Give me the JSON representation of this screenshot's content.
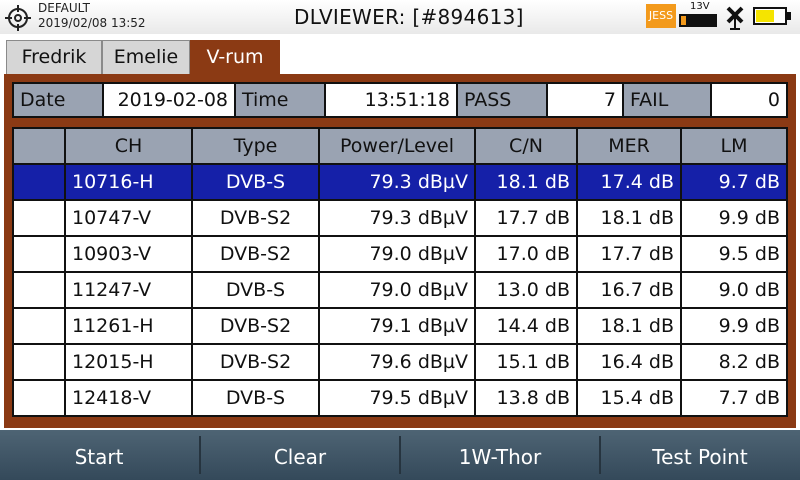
{
  "status_bar": {
    "profile": "DEFAULT",
    "datetime": "2019/02/08 13:52",
    "title": "DLVIEWER: [#894613]",
    "jess_badge": "JESS",
    "voltage": "13V",
    "voltage_level": 0.15,
    "battery_level": 0.65,
    "icons": [
      "crosshair-icon",
      "satellite-icon",
      "battery-icon"
    ]
  },
  "tabs": [
    {
      "label": "Fredrik",
      "active": false
    },
    {
      "label": "Emelie",
      "active": false
    },
    {
      "label": "V-rum",
      "active": true
    }
  ],
  "info": {
    "date_label": "Date",
    "date_value": "2019-02-08",
    "time_label": "Time",
    "time_value": "13:51:18",
    "pass_label": "PASS",
    "pass_value": "7",
    "fail_label": "FAIL",
    "fail_value": "0"
  },
  "table": {
    "headers": [
      "",
      "CH",
      "Type",
      "Power/Level",
      "C/N",
      "MER",
      "LM"
    ],
    "rows": [
      {
        "ch": "10716-H",
        "type": "DVB-S",
        "power": "79.3 dBµV",
        "cn": "18.1 dB",
        "mer": "17.4 dB",
        "lm": "9.7 dB",
        "selected": true
      },
      {
        "ch": "10747-V",
        "type": "DVB-S2",
        "power": "79.3 dBµV",
        "cn": "17.7 dB",
        "mer": "18.1 dB",
        "lm": "9.9 dB",
        "selected": false
      },
      {
        "ch": "10903-V",
        "type": "DVB-S2",
        "power": "79.0 dBµV",
        "cn": "17.0 dB",
        "mer": "17.7 dB",
        "lm": "9.5 dB",
        "selected": false
      },
      {
        "ch": "11247-V",
        "type": "DVB-S",
        "power": "79.0 dBµV",
        "cn": "13.0 dB",
        "mer": "16.7 dB",
        "lm": "9.0 dB",
        "selected": false
      },
      {
        "ch": "11261-H",
        "type": "DVB-S2",
        "power": "79.1 dBµV",
        "cn": "14.4 dB",
        "mer": "18.1 dB",
        "lm": "9.9 dB",
        "selected": false
      },
      {
        "ch": "12015-H",
        "type": "DVB-S2",
        "power": "79.6 dBµV",
        "cn": "15.1 dB",
        "mer": "16.4 dB",
        "lm": "8.2 dB",
        "selected": false
      },
      {
        "ch": "12418-V",
        "type": "DVB-S",
        "power": "79.5 dBµV",
        "cn": "13.8 dB",
        "mer": "15.4 dB",
        "lm": "7.7 dB",
        "selected": false
      }
    ]
  },
  "softkeys": [
    "Start",
    "Clear",
    "1W-Thor",
    "Test Point"
  ],
  "colors": {
    "accent": "#8b3a14",
    "selection": "#1520a8",
    "header": "#9aa3b2",
    "jess": "#f39a1c",
    "battery": "#f5e400",
    "softkey_bar": "#3f5566"
  }
}
